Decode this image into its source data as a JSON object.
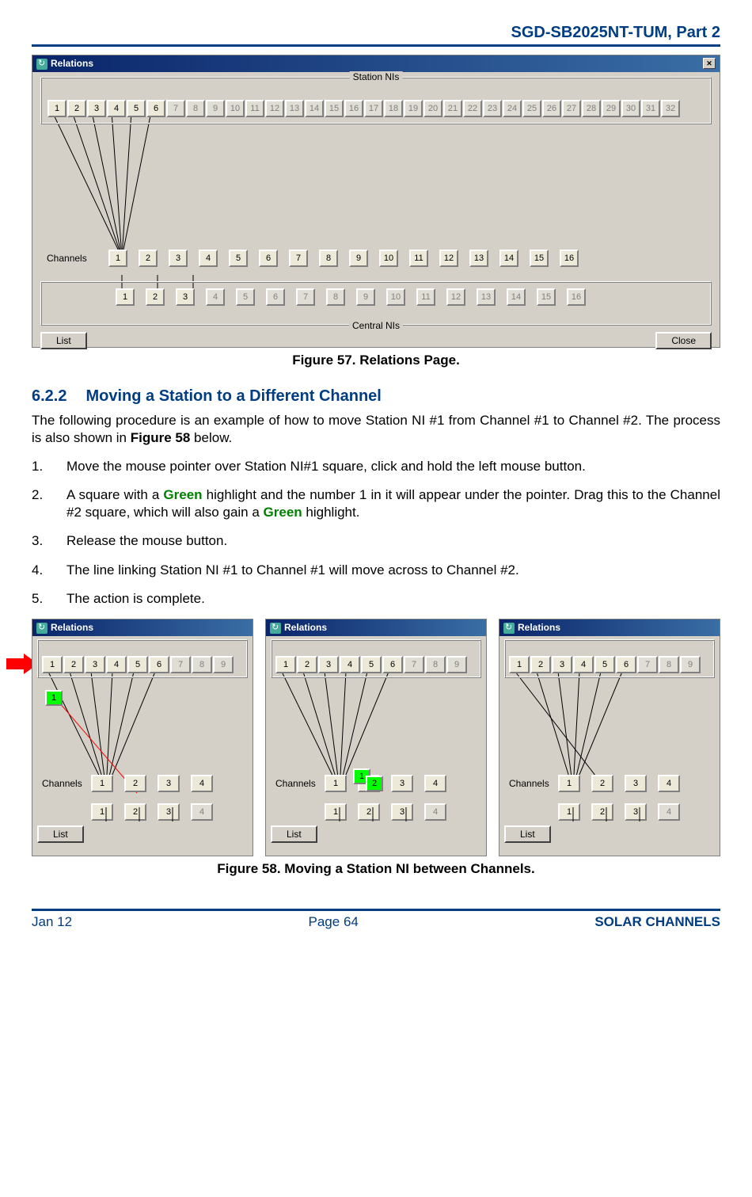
{
  "header": {
    "doc_id": "SGD-SB2025NT-TUM, Part 2"
  },
  "fig57": {
    "window_title": "Relations",
    "station_label": "Station NIs",
    "channels_label": "Channels",
    "central_label": "Central NIs",
    "list_btn": "List",
    "close_btn": "Close",
    "station_cells": [
      "1",
      "2",
      "3",
      "4",
      "5",
      "6",
      "7",
      "8",
      "9",
      "10",
      "11",
      "12",
      "13",
      "14",
      "15",
      "16",
      "17",
      "18",
      "19",
      "20",
      "21",
      "22",
      "23",
      "24",
      "25",
      "26",
      "27",
      "28",
      "29",
      "30",
      "31",
      "32"
    ],
    "station_active": 6,
    "channel_cells": [
      "1",
      "2",
      "3",
      "4",
      "5",
      "6",
      "7",
      "8",
      "9",
      "10",
      "11",
      "12",
      "13",
      "14",
      "15",
      "16"
    ],
    "central_cells": [
      "1",
      "2",
      "3",
      "4",
      "5",
      "6",
      "7",
      "8",
      "9",
      "10",
      "11",
      "12",
      "13",
      "14",
      "15",
      "16"
    ],
    "central_active": 3,
    "caption": "Figure 57.  Relations Page."
  },
  "section": {
    "num": "6.2.2",
    "title": "Moving a Station to a Different Channel",
    "para1a": "The following procedure is an example of how to move Station NI #1 from Channel #1 to Channel #2.  The process is also shown in ",
    "para1b": "Figure 58",
    "para1c": " below.",
    "step1": "Move the mouse pointer over Station NI#1 square, click and hold the left mouse button.",
    "step2a": "A square with a ",
    "step2b": "Green",
    "step2c": " highlight and the number 1 in it will appear under the pointer.  Drag this to the Channel #2 square, which will also gain a ",
    "step2d": "Green",
    "step2e": " highlight.",
    "step3": "Release the mouse button.",
    "step4": "The line linking Station NI #1 to Channel #1 will move across to Channel #2.",
    "step5": "The action is complete."
  },
  "fig58": {
    "window_title": "Relations",
    "channels_label": "Channels",
    "list_btn": "List",
    "station_cells": [
      "1",
      "2",
      "3",
      "4",
      "5",
      "6",
      "7",
      "8",
      "9"
    ],
    "station_active": 6,
    "channel_cells": [
      "1",
      "2",
      "3",
      "4"
    ],
    "central_cells": [
      "1",
      "2",
      "3",
      "4"
    ],
    "central_active": 3,
    "green_val": "1",
    "green_val2": "2",
    "caption": "Figure 58.  Moving a Station NI between Channels."
  },
  "footer": {
    "left": "Jan 12",
    "mid": "Page 64",
    "right": "SOLAR CHANNELS"
  }
}
